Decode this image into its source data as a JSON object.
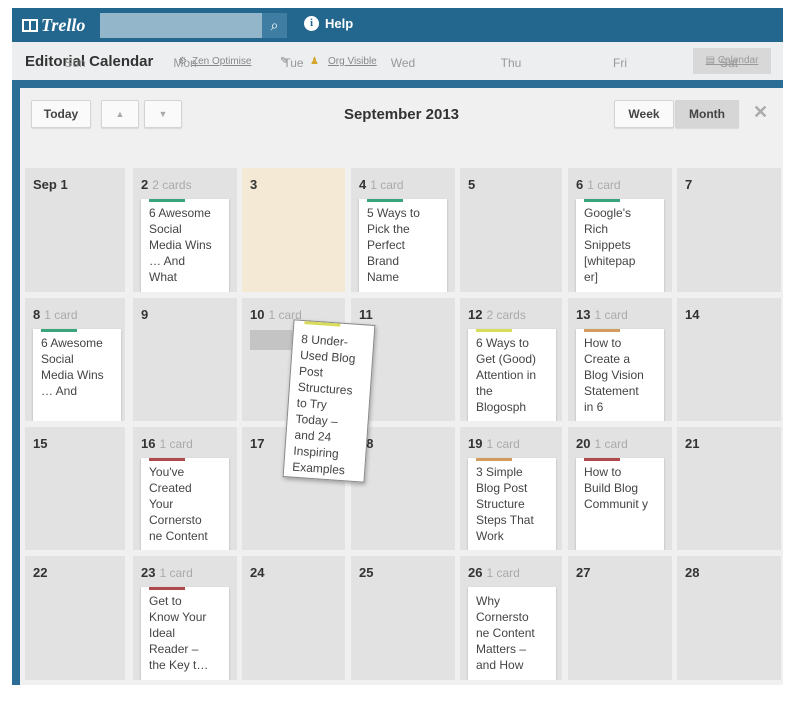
{
  "topbar": {
    "logo": "Trello",
    "search_placeholder": "",
    "help_label": "Help"
  },
  "board": {
    "title": "Editorial Calendar",
    "org_link": "Zen Optimise",
    "visibility": "Org Visible",
    "calendar_button": "Calendar"
  },
  "calendar": {
    "today_label": "Today",
    "prev_icon": "▲",
    "next_icon": "▼",
    "month_title": "September 2013",
    "week_label": "Week",
    "month_label": "Month",
    "close_icon": "✕",
    "weekdays": [
      "Sun",
      "Mon",
      "Tue",
      "Wed",
      "Thu",
      "Fri",
      "Sat"
    ],
    "colors": {
      "green": "#3aa57a",
      "yellow": "#d9dc5a",
      "orange": "#d39b5c",
      "red": "#b04a4a",
      "highlight": "#f3e9d4"
    },
    "days": [
      {
        "label": "Sep 1"
      },
      {
        "label": "2",
        "count": "2 cards",
        "card": {
          "label": "green",
          "text": "6 Awesome Social Media Wins … And What"
        }
      },
      {
        "label": "3",
        "highlight": true
      },
      {
        "label": "4",
        "count": "1 card",
        "card": {
          "label": "green",
          "text": "5 Ways to Pick the Perfect Brand Name"
        }
      },
      {
        "label": "5"
      },
      {
        "label": "6",
        "count": "1 card",
        "card": {
          "label": "green",
          "text": "Google's Rich Snippets [whitepap er]"
        }
      },
      {
        "label": "7"
      },
      {
        "label": "8",
        "count": "1 card",
        "card": {
          "label": "green",
          "text": "6 Awesome Social Media Wins … And"
        }
      },
      {
        "label": "9"
      },
      {
        "label": "10",
        "count": "1 card",
        "ghost": true
      },
      {
        "label": "11"
      },
      {
        "label": "12",
        "count": "2 cards",
        "card": {
          "label": "yellow",
          "text": "6 Ways to Get (Good) Attention in the Blogosph"
        }
      },
      {
        "label": "13",
        "count": "1 card",
        "card": {
          "label": "orange",
          "text": "How to Create a Blog Vision Statement in 6"
        }
      },
      {
        "label": "14"
      },
      {
        "label": "15"
      },
      {
        "label": "16",
        "count": "1 card",
        "card": {
          "label": "red",
          "text": "You've Created Your Cornersto ne Content"
        }
      },
      {
        "label": "17"
      },
      {
        "label": "18"
      },
      {
        "label": "19",
        "count": "1 card",
        "card": {
          "label": "orange",
          "text": "3 Simple Blog Post Structure Steps That Work"
        }
      },
      {
        "label": "20",
        "count": "1 card",
        "card": {
          "label": "red",
          "text": "How to Build Blog Communit y"
        }
      },
      {
        "label": "21"
      },
      {
        "label": "22"
      },
      {
        "label": "23",
        "count": "1 card",
        "card": {
          "label": "red",
          "text": "Get to Know Your Ideal Reader – the Key to Your"
        }
      },
      {
        "label": "24"
      },
      {
        "label": "25"
      },
      {
        "label": "26",
        "count": "1 card",
        "card": {
          "label": "",
          "text": "Why Cornersto ne Content Matters – and How"
        }
      },
      {
        "label": "27"
      },
      {
        "label": "28"
      }
    ],
    "dragged_card": {
      "label": "yellow",
      "text": "8 Under-Used Blog Post Structures to Try Today – and 24 Inspiring Examples"
    }
  }
}
